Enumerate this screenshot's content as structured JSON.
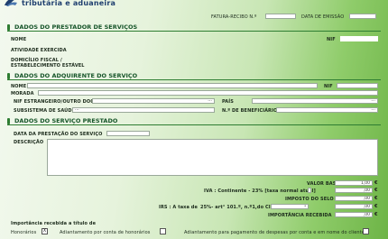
{
  "header": {
    "brand_line": "tributária e aduaneira",
    "invoice_label": "FATURA-RECIBO N.º",
    "invoice_number": "",
    "issue_date_label": "DATA DE EMISSÃO",
    "issue_date": ""
  },
  "provider": {
    "section_title": "DADOS DO PRESTADOR DE SERVIÇOS",
    "name_label": "NOME",
    "nif_label": "NIF",
    "activity_label": "ATIVIDADE EXERCIDA",
    "address_label_1": "DOMICÍLIO FISCAL /",
    "address_label_2": "ESTABELECIMENTO ESTÁVEL"
  },
  "acquirer": {
    "section_title": "DADOS DO ADQUIRENTE DO SERVIÇO",
    "name_label": "NOME",
    "nif_label": "NIF",
    "address_label": "MORADA",
    "foreign_nif_label": "NIF ESTRANGEIRO/OUTRO DOC.IDENT.",
    "foreign_nif_value": "...",
    "country_label": "PAÍS",
    "country_value": "...",
    "health_subsystem_label": "SUBSISTEMA DE SAÚDE",
    "health_subsystem_value": "...",
    "beneficiary_label": "N.º DE BENEFICIÁRIO",
    "beneficiary_value": "..."
  },
  "service": {
    "section_title": "DADOS DO SERVIÇO PRESTADO",
    "date_label": "DATA DA PRESTAÇÃO DO SERVIÇO",
    "description_label": "DESCRIÇÃO"
  },
  "totals": {
    "base_label": "VALOR BASE",
    "base_value": "1,00",
    "iva_label": "IVA : Continente - 23% [taxa normal atual]",
    "iva_value": ",00",
    "stamp_label": "IMPOSTO DO SELO",
    "stamp_value": ",00",
    "irs_label": "IRS : A taxa de",
    "irs_rate_text": "25%- art° 101.º, n.º1,do CIRS.",
    "irs_value": ",00",
    "received_label": "IMPORTÂNCIA RECEBIDA",
    "received_value": ",00",
    "currency": "€"
  },
  "footer": {
    "received_title": "Importância recebida a título de",
    "fees_label": "Honorários",
    "fees_checked": "X",
    "advance_fees_label": "Adiantamento por conta de honorários",
    "advance_expenses_label": "Adiantamento para pagamento de despesas por conta e em nome do cliente"
  },
  "colors": {
    "section_green": "#17552a",
    "accent_green": "#2e7d32",
    "brand_blue": "#1f3f6f"
  }
}
